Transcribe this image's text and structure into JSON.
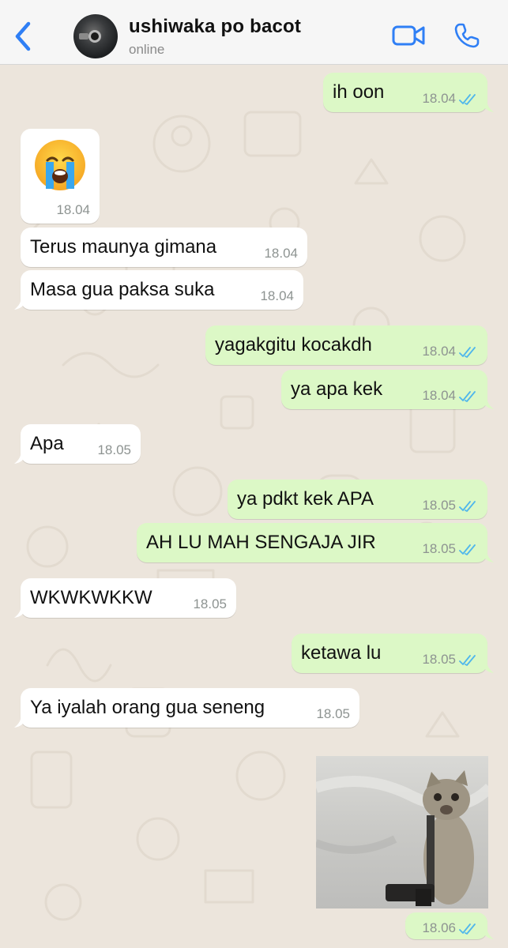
{
  "header": {
    "contact_name": "ushiwaka po bacot",
    "status": "online",
    "icons": {
      "back": "chevron-left-icon",
      "video": "video-camera-icon",
      "call": "phone-icon"
    }
  },
  "theme": {
    "accent": "#2f7ff5",
    "incoming": "#ffffff",
    "outgoing": "#dcf8c6",
    "read_ticks": "#4fb6ec"
  },
  "messages": [
    {
      "dir": "out",
      "text": "ih oon",
      "time": "18.04",
      "read": true
    },
    {
      "dir": "in",
      "kind": "emoji",
      "emoji": "loudly-crying-face",
      "time": "18.04"
    },
    {
      "dir": "in",
      "text": "Terus maunya gimana",
      "time": "18.04"
    },
    {
      "dir": "in",
      "text": "Masa gua paksa suka",
      "time": "18.04"
    },
    {
      "dir": "out",
      "text": "yagakgitu kocakdh",
      "time": "18.04",
      "read": true
    },
    {
      "dir": "out",
      "text": "ya apa kek",
      "time": "18.04",
      "read": true
    },
    {
      "dir": "in",
      "text": "Apa",
      "time": "18.05"
    },
    {
      "dir": "out",
      "text": "ya pdkt kek APA",
      "time": "18.05",
      "read": true
    },
    {
      "dir": "out",
      "text": "AH LU MAH SENGAJA JIR",
      "time": "18.05",
      "read": true
    },
    {
      "dir": "in",
      "text": "WKWKWKKW",
      "time": "18.05"
    },
    {
      "dir": "out",
      "text": "ketawa lu",
      "time": "18.05",
      "read": true
    },
    {
      "dir": "in",
      "text": "Ya iyalah orang gua seneng",
      "time": "18.05"
    },
    {
      "dir": "out",
      "kind": "image",
      "image": "cat-holding-gun-photo",
      "time": "18.06",
      "read": true
    }
  ]
}
